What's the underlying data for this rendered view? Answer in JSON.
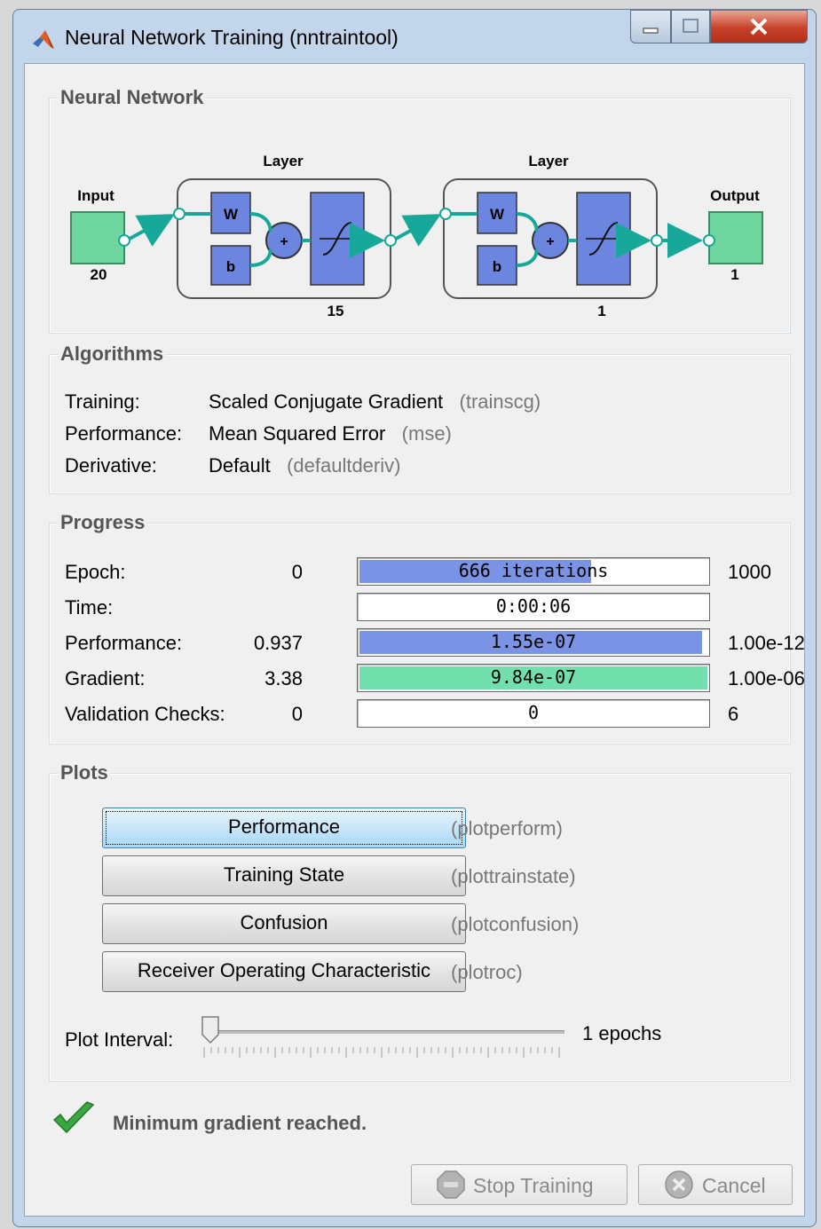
{
  "window": {
    "title": "Neural Network Training (nntraintool)"
  },
  "network": {
    "section_title": "Neural Network",
    "input_label": "Input",
    "input_size": "20",
    "output_label": "Output",
    "output_size": "1",
    "layers": [
      {
        "title": "Layer",
        "w": "W",
        "b": "b",
        "plus": "+",
        "size": "15"
      },
      {
        "title": "Layer",
        "w": "W",
        "b": "b",
        "plus": "+",
        "size": "1"
      }
    ]
  },
  "algorithms": {
    "section_title": "Algorithms",
    "rows": [
      {
        "label": "Training:",
        "value": "Scaled Conjugate Gradient",
        "fn": "(trainscg)"
      },
      {
        "label": "Performance:",
        "value": "Mean Squared Error",
        "fn": "(mse)"
      },
      {
        "label": "Derivative:",
        "value": "Default",
        "fn": "(defaultderiv)"
      }
    ]
  },
  "progress": {
    "section_title": "Progress",
    "rows": [
      {
        "label": "Epoch:",
        "start": "0",
        "bar_text": "666 iterations",
        "end": "1000",
        "fill": 0.665,
        "color": "#7b93e4"
      },
      {
        "label": "Time:",
        "start": "",
        "bar_text": "0:00:06",
        "end": "",
        "fill": 0,
        "color": "#7b93e4"
      },
      {
        "label": "Performance:",
        "start": "0.937",
        "bar_text": "1.55e-07",
        "end": "1.00e-12",
        "fill": 0.985,
        "color": "#7b93e4"
      },
      {
        "label": "Gradient:",
        "start": "3.38",
        "bar_text": "9.84e-07",
        "end": "1.00e-06",
        "fill": 1.0,
        "color": "#72e0ad"
      },
      {
        "label": "Validation Checks:",
        "start": "0",
        "bar_text": "0",
        "end": "6",
        "fill": 0,
        "color": "#7b93e4"
      }
    ]
  },
  "plots": {
    "section_title": "Plots",
    "buttons": [
      {
        "label": "Performance",
        "fn": "(plotperform)"
      },
      {
        "label": "Training State",
        "fn": "(plottrainstate)"
      },
      {
        "label": "Confusion",
        "fn": "(plotconfusion)"
      },
      {
        "label": "Receiver Operating Characteristic",
        "fn": "(plotroc)"
      }
    ],
    "interval_label": "Plot Interval:",
    "interval_value": "1 epochs",
    "slider_fraction": 0
  },
  "status": {
    "message": "Minimum gradient reached."
  },
  "buttons": {
    "stop": "Stop Training",
    "cancel": "Cancel"
  },
  "colors": {
    "node_fill": "#6fd6a0",
    "layer_fill": "#6c86e0",
    "accent_teal": "#18a89a",
    "check_green": "#3aa640"
  },
  "icons": [
    "matlab-logo-icon",
    "minimize-icon",
    "maximize-icon",
    "close-icon",
    "checkmark-icon",
    "stop-icon",
    "cancel-icon"
  ]
}
